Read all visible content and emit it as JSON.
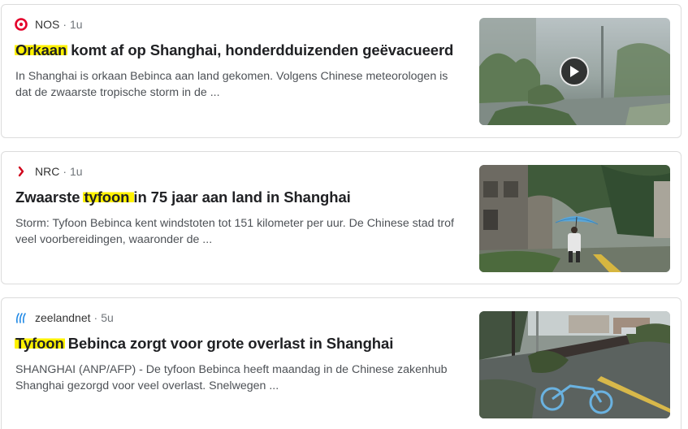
{
  "articles": [
    {
      "source": "NOS",
      "separator": "·",
      "age": "1u",
      "icon": "nos-logo-icon",
      "headline_highlight": "Orkaan",
      "headline_rest": " komt af op Shanghai, honderdduizenden geëvacueerd",
      "snippet": "In Shanghai is orkaan Bebinca aan land gekomen. Volgens Chinese meteorologen is dat de zwaarste tropische storm in de ...",
      "has_video": true
    },
    {
      "source": "NRC",
      "separator": "·",
      "age": "1u",
      "icon": "nrc-logo-icon",
      "headline_before": "Zwaarste ",
      "headline_highlight": "tyfoon ",
      "headline_rest": "in 75 jaar aan land in Shanghai",
      "snippet": "Storm: Tyfoon Bebinca kent windstoten tot 151 kilometer per uur. De Chinese stad trof veel voorbereidingen, waaronder de ...",
      "has_video": false
    },
    {
      "source": "zeelandnet",
      "separator": "·",
      "age": "5u",
      "icon": "zeelandnet-logo-icon",
      "headline_highlight": "Tyfoon",
      "headline_rest": " Bebinca zorgt voor grote overlast in Shanghai",
      "snippet": "SHANGHAI (ANP/AFP) - De tyfoon Bebinca heeft maandag in de Chinese zakenhub Shanghai gezorgd voor veel overlast. Snelwegen ...",
      "has_video": false
    }
  ],
  "colors": {
    "highlight": "#fff200",
    "nos_red": "#e4002b",
    "nrc_red": "#d0021b",
    "zeelandnet_blue": "#1e88e5"
  }
}
